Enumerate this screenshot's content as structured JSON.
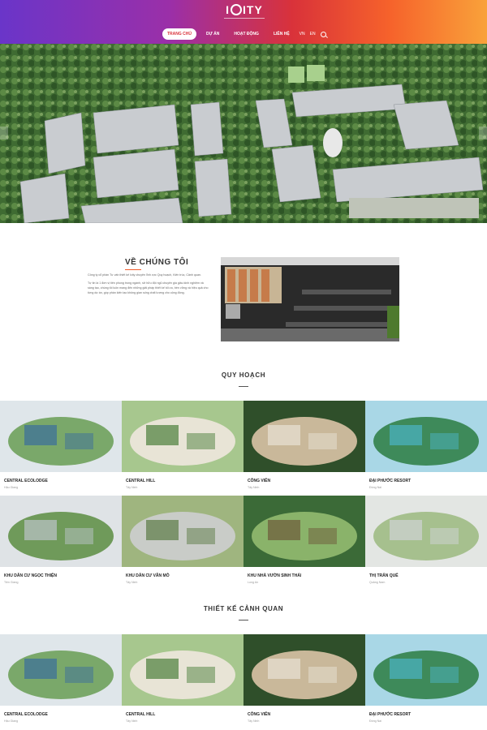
{
  "header": {
    "logo": "ICITY",
    "nav": [
      {
        "label": "Trang chủ",
        "active": true
      },
      {
        "label": "Dự án",
        "active": false
      },
      {
        "label": "Hoạt động",
        "active": false
      },
      {
        "label": "Liên hệ",
        "active": false
      }
    ],
    "flags": [
      "VN",
      "EN"
    ],
    "colors": {
      "grad_start": "#6a35c9",
      "grad_mid": "#d9323a",
      "grad_end": "#f9a23a"
    }
  },
  "about": {
    "title": "VỀ CHÚNG TÔI",
    "para1": "Công ty cổ phần Tư vấn thiết kế Icity chuyên lĩnh vực Quy hoạch, Kiến trúc, Cảnh quan.",
    "para2": "Tự tin là 1 đơn vị tiên phong trong ngành, sở hữu đội ngũ chuyên gia giàu kinh nghiệm và sáng tạo, chúng tôi luôn mang đến những giải pháp thiết kế tối ưu, bền vững và hiệu quả cho từng dự án, góp phần kiến tạo không gian sống chất lượng cho cộng đồng."
  },
  "sections": [
    {
      "title": "QUY HOẠCH",
      "items": [
        {
          "name": "Central Ecolodge",
          "sub": "Hậu Giang"
        },
        {
          "name": "Central Hill",
          "sub": "Tây Ninh"
        },
        {
          "name": "Công viên",
          "sub": "Tây Ninh"
        },
        {
          "name": "Đại Phước Resort",
          "sub": "Đồng Nai"
        },
        {
          "name": "Khu dân cư Ngọc Thiện",
          "sub": "Tiền Giang"
        },
        {
          "name": "Khu dân cư Văn Mỗ",
          "sub": "Tây Ninh"
        },
        {
          "name": "Khu nhà vườn sinh thái",
          "sub": "Long An"
        },
        {
          "name": "Thị trấn Quế",
          "sub": "Quảng Nam"
        }
      ]
    },
    {
      "title": "THIẾT KẾ CẢNH QUAN",
      "items": [
        {
          "name": "Central Ecolodge",
          "sub": "Hậu Giang"
        },
        {
          "name": "Central Hill",
          "sub": "Tây Ninh"
        },
        {
          "name": "Công viên",
          "sub": "Tây Ninh"
        },
        {
          "name": "Đại Phước Resort",
          "sub": "Đồng Nai"
        }
      ]
    }
  ]
}
